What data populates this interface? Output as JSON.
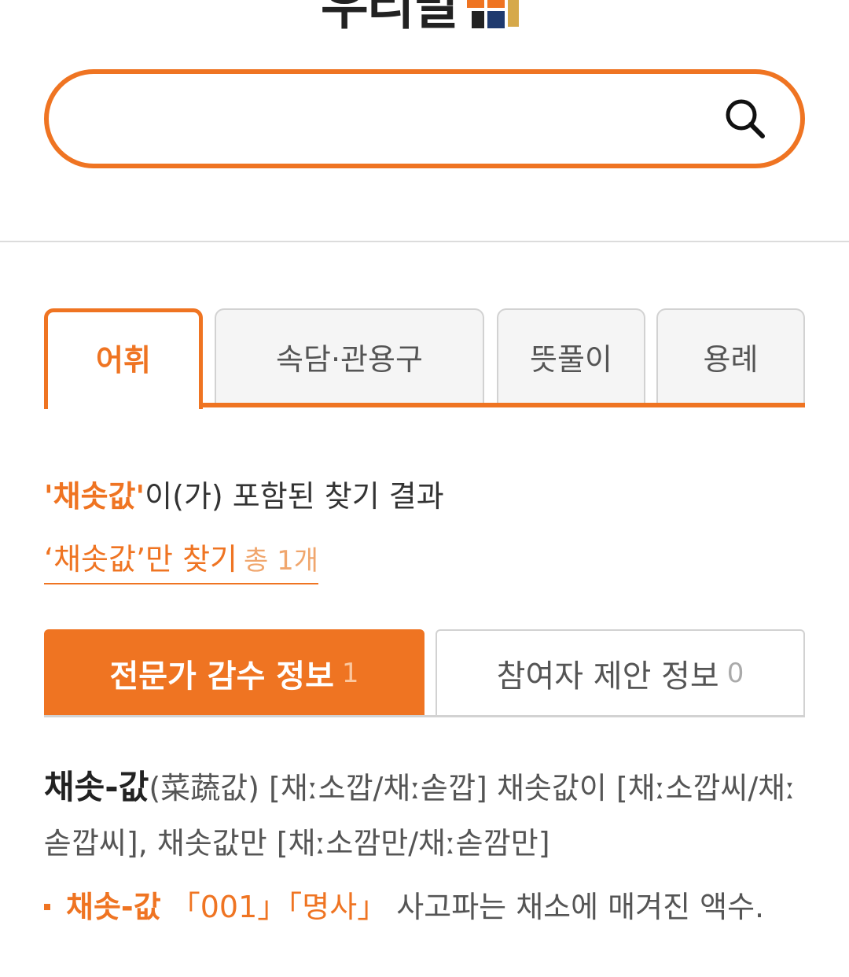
{
  "logo": {
    "text": "우리말샘"
  },
  "search": {
    "value": "",
    "placeholder": ""
  },
  "tabs": [
    {
      "label": "어휘",
      "active": true
    },
    {
      "label": "속담·관용구",
      "active": false
    },
    {
      "label": "뜻풀이",
      "active": false
    },
    {
      "label": "용례",
      "active": false
    }
  ],
  "result": {
    "keyword": "'채솟값'",
    "suffix": "이(가) 포함된 찾기 결과",
    "exact_link": "‘채솟값’만 찾기",
    "exact_count": "총 1개"
  },
  "info_tabs": {
    "expert_label": "전문가 감수 정보",
    "expert_count": "1",
    "suggest_label": "참여자 제안 정보",
    "suggest_count": "0"
  },
  "entry": {
    "headword": "채솟-값",
    "details": "(菜蔬값) [채ː소깝/채ː솓깝] 채솟값이 [채ː소깝씨/채ː솓깝씨], 채솟값만 [채ː소깜만/채ː솓깜만]"
  },
  "sense": {
    "headword": "채솟-값",
    "number": "「001」",
    "pos": "「명사」",
    "definition": "사고파는 채소에 매겨진 액수."
  },
  "colors": {
    "accent": "#ef7422",
    "border": "#d2d2d2"
  }
}
